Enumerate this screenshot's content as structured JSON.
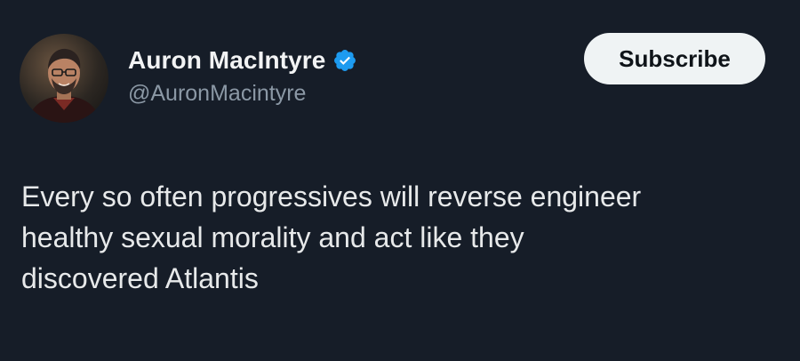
{
  "author": {
    "display_name": "Auron MacIntyre",
    "handle": "@AuronMacintyre",
    "avatar_icon": "profile-photo",
    "verified_icon": "verified-badge-icon",
    "verified_color": "#1d9bf0"
  },
  "actions": {
    "subscribe_label": "Subscribe"
  },
  "tweet": {
    "lines": [
      "Every so often progressives will reverse engineer",
      "healthy sexual morality and act like they",
      "discovered Atlantis"
    ]
  },
  "colors": {
    "background": "#161d28",
    "text": "#e7e9ea",
    "secondary_text": "#8b98a5",
    "button_bg": "#eff3f4"
  }
}
